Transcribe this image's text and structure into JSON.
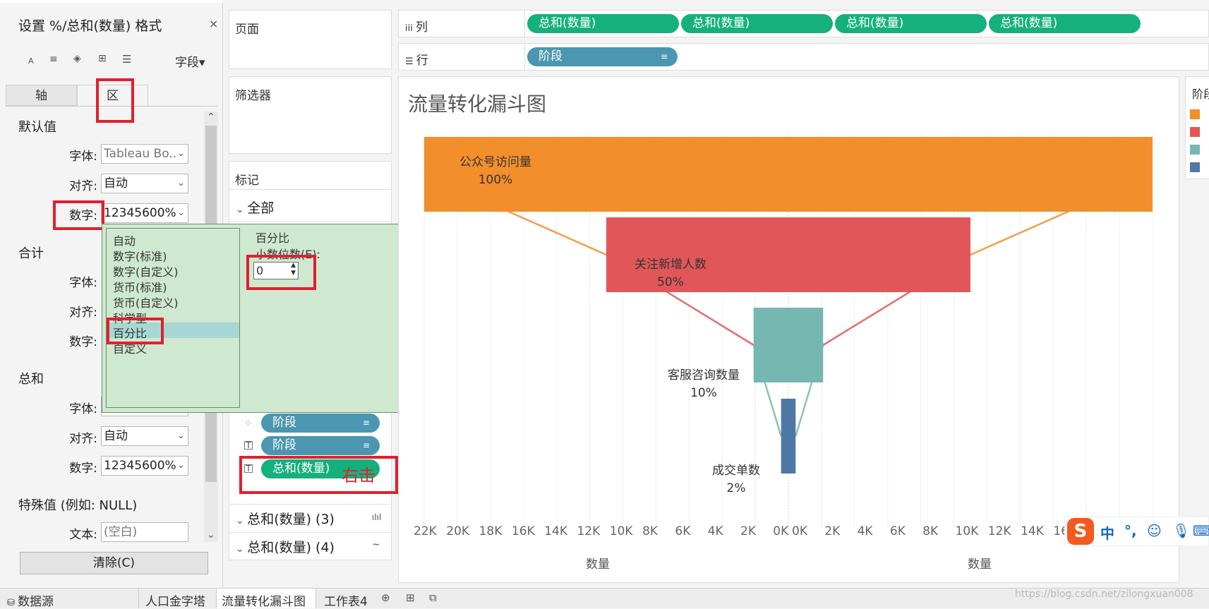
{
  "format_pane": {
    "title": "设置 %/总和(数量) 格式",
    "close": "×",
    "field_dropdown": "字段▾",
    "tab_axis": "轴",
    "tab_pane": "区",
    "section_default": "默认值",
    "section_total": "合计",
    "section_grand": "总和",
    "section_special": "特殊值 (例如: NULL)",
    "label_font": "字体:",
    "label_align": "对齐:",
    "label_number": "数字:",
    "label_text": "文本:",
    "default_font_value": "Tableau Bo..",
    "default_align_value": "自动",
    "default_number_value": "12345600%",
    "grand_align_value": "自动",
    "grand_number_value": "12345600%",
    "text_placeholder": "(空白)",
    "clear_button": "清除(C)"
  },
  "number_popup": {
    "options": [
      "自动",
      "数字(标准)",
      "数字(自定义)",
      "货币(标准)",
      "货币(自定义)",
      "科学型",
      "百分比",
      "自定义"
    ],
    "selected": "百分比",
    "detail_title": "百分比",
    "decimal_label": "小数位数(E):",
    "decimal_value": "0"
  },
  "pages_card": {
    "title": "页面"
  },
  "filters_card": {
    "title": "筛选器"
  },
  "marks_card": {
    "title": "标记",
    "all_label": "全部",
    "pills": [
      "阶段",
      "阶段",
      "总和(数量)"
    ],
    "group_3": "总和(数量) (3)",
    "group_4": "总和(数量) (4)",
    "annotation": "右击"
  },
  "shelves": {
    "columns_label": "列",
    "rows_label": "行",
    "column_pills": [
      "总和(数量)",
      "总和(数量)",
      "总和(数量)",
      "总和(数量)"
    ],
    "row_pill": "阶段"
  },
  "viz": {
    "title": "流量转化漏斗图",
    "x_ticks_left": [
      "22K",
      "20K",
      "18K",
      "16K",
      "14K",
      "12K",
      "10K",
      "8K",
      "6K",
      "4K",
      "2K",
      "0K"
    ],
    "x_ticks_right": [
      "0K",
      "2K",
      "4K",
      "6K",
      "8K",
      "10K",
      "12K",
      "14K",
      "16K"
    ],
    "axis_title_left": "数量",
    "axis_title_right": "数量"
  },
  "chart_data": {
    "type": "bar",
    "title": "流量转化漏斗图",
    "categories": [
      "公众号访问量",
      "关注新增人数",
      "客服咨询数量",
      "成交单数"
    ],
    "values": [
      22000,
      11000,
      2100,
      440
    ],
    "percent_labels": [
      "100%",
      "50%",
      "10%",
      "2%"
    ],
    "colors": [
      "#f28e2b",
      "#e15759",
      "#76b7b2",
      "#4e79a7"
    ],
    "xlabel": "数量",
    "xlim": [
      -22000,
      22000
    ],
    "grid": true,
    "legend_position": "right"
  },
  "legend": {
    "title": "阶段",
    "colors": [
      "#f28e2b",
      "#e15759",
      "#76b7b2",
      "#4e79a7"
    ]
  },
  "bottom_tabs": [
    "数据源",
    "人口金字塔",
    "流量转化漏斗图",
    "工作表4"
  ],
  "watermark": "https://blog.csdn.net/zilongxuan008",
  "ime": {
    "chinese": "中",
    "punct": "°,"
  }
}
